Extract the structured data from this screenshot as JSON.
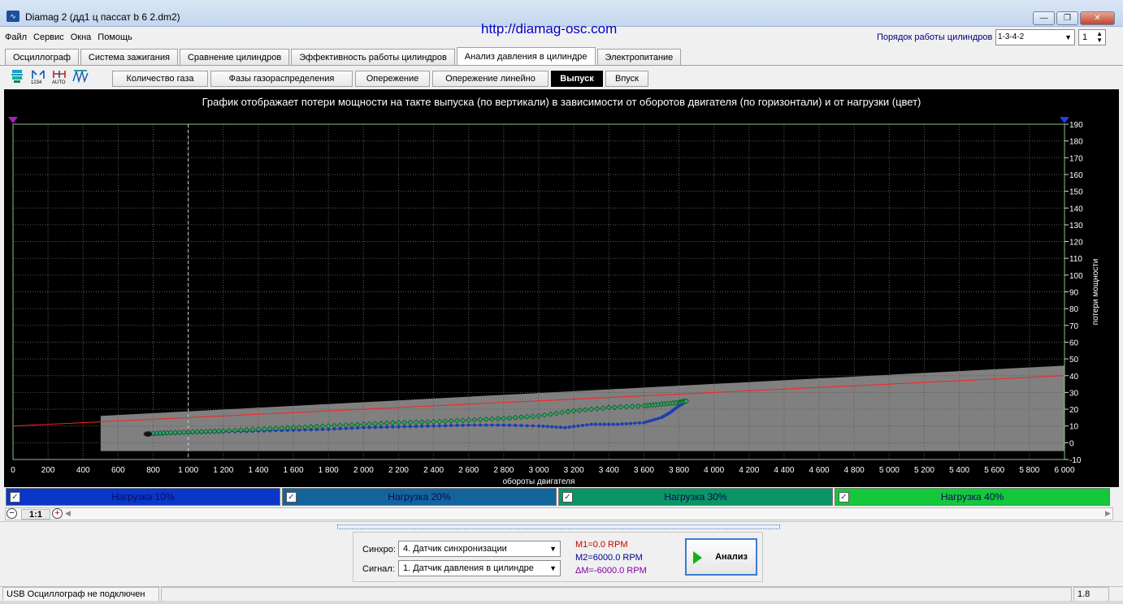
{
  "window": {
    "title": "Diamag 2 (дд1 ц пассат b 6 2.dm2)",
    "app_icon": "waveform-icon"
  },
  "menu": [
    "Файл",
    "Сервис",
    "Окна",
    "Помощь"
  ],
  "url": "http://diamag-osc.com",
  "cyl_order": {
    "label": "Порядок работы цилиндров",
    "value": "1-3-4-2",
    "count": "1"
  },
  "main_tabs": [
    "Осциллограф",
    "Система зажигания",
    "Сравнение цилиндров",
    "Эффективность работы цилиндров",
    "Анализ давления в цилиндре",
    "Электропитание"
  ],
  "active_main_tab": "Анализ давления в цилиндре",
  "toolbar_icons": [
    "cylinder-select-icon",
    "numbering-icon",
    "auto-scale-icon",
    "wave-icon"
  ],
  "sub_tabs": [
    "Количество газа",
    "Фазы газораспределения",
    "Опережение",
    "Опережение линейно",
    "Выпуск",
    "Впуск"
  ],
  "active_sub_tab": "Выпуск",
  "colors": {
    "chart_bg": "#000000",
    "grid": "#5a5a5a",
    "zone": "#808080",
    "line_red": "#ff2020",
    "series_blue": "#1e3eb4",
    "series_green": "#2fa860",
    "load10": "#0a37c8",
    "load20": "#14649c",
    "load30": "#0a9664",
    "load40": "#14c83c"
  },
  "chart_data": {
    "type": "scatter",
    "title": "График отображает потери мощности на такте выпуска (по вертикали) в зависимости от оборотов двигателя (по горизонтали) и от нагрузки (цвет)",
    "xlabel": "обороты двигателя",
    "ylabel": "потери мощности",
    "xlim": [
      0,
      6000
    ],
    "ylim": [
      -10,
      190
    ],
    "xticks": [
      "0",
      "200",
      "400",
      "600",
      "800",
      "1 000",
      "1 200",
      "1 400",
      "1 600",
      "1 800",
      "2 000",
      "2 200",
      "2 400",
      "2 600",
      "2 800",
      "3 000",
      "3 200",
      "3 400",
      "3 600",
      "3 800",
      "4 000",
      "4 200",
      "4 400",
      "4 600",
      "4 800",
      "5 000",
      "5 200",
      "5 400",
      "5 600",
      "5 800",
      "6 000"
    ],
    "yticks": [
      "-10",
      "0",
      "10",
      "20",
      "30",
      "40",
      "50",
      "60",
      "70",
      "80",
      "90",
      "100",
      "110",
      "120",
      "130",
      "140",
      "150",
      "160",
      "170",
      "180",
      "190"
    ],
    "grid": true,
    "marker_x": 1000,
    "gray_zone": {
      "x": [
        500,
        6000
      ],
      "y_bottom": -5,
      "y_top_start": 16,
      "y_top_end": 46
    },
    "red_line": {
      "x": [
        0,
        6000
      ],
      "y": [
        10,
        40
      ]
    },
    "series": [
      {
        "name": "Нагрузка 10%",
        "color": "#1e3eb4",
        "x": [
          760,
          900,
          1050,
          1200,
          1400,
          1600,
          1800,
          2000,
          2200,
          2400,
          2600,
          2800,
          3000,
          3150,
          3300,
          3450,
          3600,
          3700,
          3750,
          3800,
          3830
        ],
        "y": [
          5,
          5.5,
          6,
          6.5,
          7,
          7.5,
          8,
          9,
          9.5,
          10,
          10.5,
          10.5,
          10,
          9,
          11,
          11,
          12,
          15,
          18,
          22,
          24
        ]
      },
      {
        "name": "Нагрузка 30%",
        "color": "#2fa860",
        "x": [
          780,
          900,
          1050,
          1200,
          1400,
          1600,
          1800,
          2000,
          2200,
          2400,
          2600,
          2800,
          3000,
          3200,
          3400,
          3600,
          3700,
          3800,
          3850
        ],
        "y": [
          5.5,
          6,
          6.5,
          7,
          8,
          9,
          10,
          11,
          12,
          12.5,
          13.5,
          14.5,
          16,
          19,
          21,
          22,
          23,
          24,
          25
        ]
      }
    ]
  },
  "legend": [
    "Нагрузка 10%",
    "Нагрузка 20%",
    "Нагрузка 30%",
    "Нагрузка 40%"
  ],
  "zoom": {
    "ratio": "1:1"
  },
  "controls": {
    "sync_label": "Синхро:",
    "sync_value": "4.  Датчик синхронизации",
    "signal_label": "Сигнал:",
    "signal_value": "1.  Датчик давления в цилиндре",
    "m1": "M1=0.0 RPM",
    "m2": "M2=6000.0 RPM",
    "dm": "ΔM=-6000.0 RPM",
    "analyze": "Анализ"
  },
  "status": {
    "text": "USB Осциллограф не подключен",
    "version": "1.8"
  }
}
